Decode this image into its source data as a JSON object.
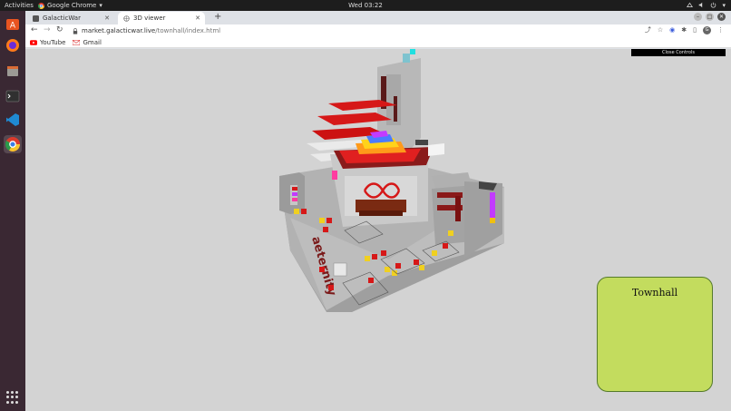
{
  "topbar": {
    "activities": "Activities",
    "app_name": "Google Chrome",
    "clock": "Wed 03:22"
  },
  "dock": {
    "apps": [
      "ubuntu-software-icon",
      "firefox-icon",
      "files-icon",
      "terminal-icon",
      "vscode-icon",
      "chrome-icon"
    ]
  },
  "browser": {
    "tabs": [
      {
        "title": "GalacticWar"
      },
      {
        "title": "3D viewer"
      }
    ],
    "url_host": "market.galacticwar.live",
    "url_path": "/townhall/index.html",
    "bookmarks": [
      {
        "label": "YouTube"
      },
      {
        "label": "Gmail"
      }
    ],
    "profile_initial": "G"
  },
  "page": {
    "close_controls": "Close Controls",
    "info_title": "Townhall",
    "scene_text": "aeternity"
  },
  "colors": {
    "accent_red": "#d61818",
    "panel_green": "#c3dc5e",
    "viewport_bg": "#d3d3d3"
  }
}
